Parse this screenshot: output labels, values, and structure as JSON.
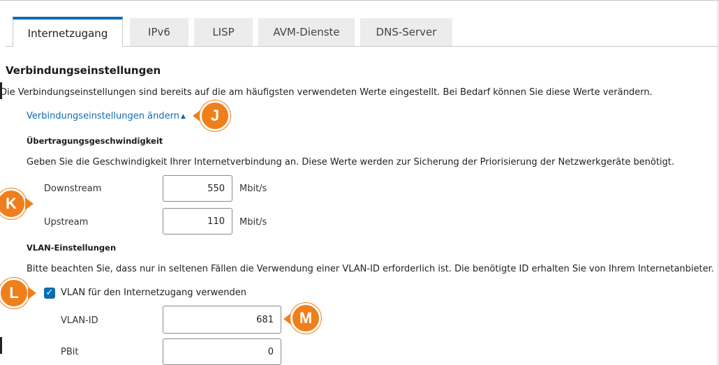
{
  "tabs": [
    {
      "label": "Internetzugang",
      "active": true
    },
    {
      "label": "IPv6",
      "active": false
    },
    {
      "label": "LISP",
      "active": false
    },
    {
      "label": "AVM-Dienste",
      "active": false
    },
    {
      "label": "DNS-Server",
      "active": false
    }
  ],
  "section": {
    "title": "Verbindungseinstellungen",
    "intro": "Die Verbindungseinstellungen sind bereits auf die am häufigsten verwendeten Werte eingestellt. Bei Bedarf können Sie diese Werte verändern.",
    "toggle_link": "Verbindungseinstellungen ändern",
    "toggle_arrow": "▲"
  },
  "speed": {
    "heading": "Übertragungsgeschwindigkeit",
    "description": "Geben Sie die Geschwindigkeit Ihrer Internetverbindung an. Diese Werte werden zur Sicherung der Priorisierung der Netzwerkgeräte benötigt.",
    "downstream_label": "Downstream",
    "downstream_value": "550",
    "downstream_unit": "Mbit/s",
    "upstream_label": "Upstream",
    "upstream_value": "110",
    "upstream_unit": "Mbit/s"
  },
  "vlan": {
    "heading": "VLAN-Einstellungen",
    "description": "Bitte beachten Sie, dass nur in seltenen Fällen die Verwendung einer VLAN-ID erforderlich ist. Die benötigte ID erhalten Sie von Ihrem Internetanbieter.",
    "checkbox_label": "VLAN für den Internetzugang verwenden",
    "checkbox_checked": true,
    "vlan_id_label": "VLAN-ID",
    "vlan_id_value": "681",
    "pbit_label": "PBit",
    "pbit_value": "0"
  },
  "callouts": {
    "j": "J",
    "k": "K",
    "l": "L",
    "m": "M",
    "color": "#f07f1b"
  },
  "colors": {
    "accent": "#0d6db3",
    "tab_inactive": "#ececec"
  }
}
